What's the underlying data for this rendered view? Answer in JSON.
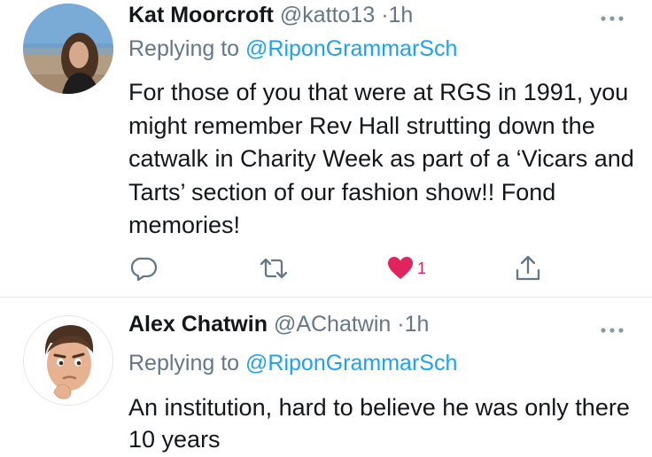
{
  "tweets": [
    {
      "name": "Kat Moorcroft",
      "handle": "@katto13",
      "separator": "·",
      "time": "1h",
      "replying_prefix": "Replying to",
      "replying_to": "@RiponGrammarSch",
      "text": "For those of you that were at RGS in 1991, you might remember Rev Hall strutting down the catwalk in Charity Week as part of a ‘Vicars and Tarts’ section of our fashion show!! Fond memories!",
      "actions": {
        "reply_icon": "comment-icon",
        "retweet_icon": "retweet-icon",
        "like_icon": "heart-filled-icon",
        "like_count": "1",
        "share_icon": "share-icon"
      }
    },
    {
      "name": "Alex Chatwin",
      "handle": "@AChatwin",
      "separator": "·",
      "time": "1h",
      "replying_prefix": "Replying to",
      "replying_to": "@RiponGrammarSch",
      "text": "An institution, hard to believe he was only there 10 years"
    }
  ],
  "colors": {
    "link": "#1da1f2",
    "secondary": "#657786",
    "like": "#e0245e",
    "divider": "#e1e6ea"
  }
}
